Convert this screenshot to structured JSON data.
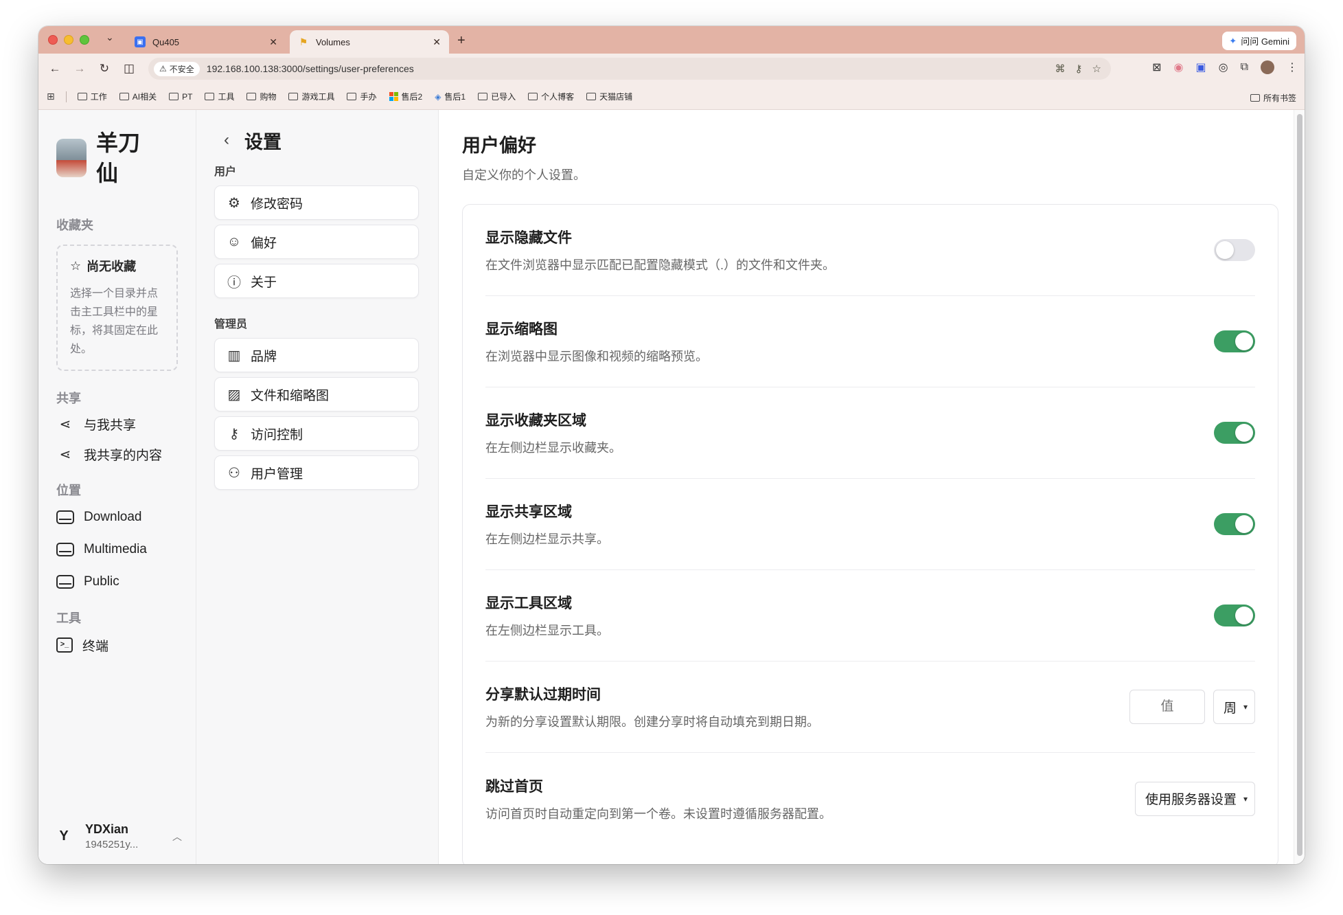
{
  "browser": {
    "tabs": [
      {
        "title": "Qu405",
        "favicon": "app-square-icon"
      },
      {
        "title": "Volumes",
        "favicon": "folder-flag-icon"
      }
    ],
    "gemini_label": "问问 Gemini",
    "security_label": "不安全",
    "url": "192.168.100.138:3000/settings/user-preferences",
    "bookmarks": [
      "工作",
      "AI相关",
      "PT",
      "工具",
      "购物",
      "游戏工具",
      "手办",
      "售后2",
      "售后1",
      "已导入",
      "个人博客",
      "天猫店铺"
    ],
    "all_bookmarks": "所有书签"
  },
  "sidebar": {
    "brand": "羊刀仙",
    "favorites_heading": "收藏夹",
    "favorites_empty_title": "尚无收藏",
    "favorites_empty_text": "选择一个目录并点击主工具栏中的星标，将其固定在此处。",
    "shared_heading": "共享",
    "shared_items": [
      "与我共享",
      "我共享的内容"
    ],
    "locations_heading": "位置",
    "locations": [
      "Download",
      "Multimedia",
      "Public"
    ],
    "tools_heading": "工具",
    "tools": [
      "终端"
    ],
    "user": {
      "initial": "Y",
      "name": "YDXian",
      "email": "1945251y..."
    }
  },
  "settings_nav": {
    "title": "设置",
    "user_group": "用户",
    "user_items": [
      "修改密码",
      "偏好",
      "关于"
    ],
    "admin_group": "管理员",
    "admin_items": [
      "品牌",
      "文件和缩略图",
      "访问控制",
      "用户管理"
    ]
  },
  "main": {
    "title": "用户偏好",
    "subtitle": "自定义你的个人设置。",
    "rows": [
      {
        "title": "显示隐藏文件",
        "desc": "在文件浏览器中显示匹配已配置隐藏模式（.）的文件和文件夹。",
        "enabled": false
      },
      {
        "title": "显示缩略图",
        "desc": "在浏览器中显示图像和视频的缩略预览。",
        "enabled": true
      },
      {
        "title": "显示收藏夹区域",
        "desc": "在左侧边栏显示收藏夹。",
        "enabled": true
      },
      {
        "title": "显示共享区域",
        "desc": "在左侧边栏显示共享。",
        "enabled": true
      },
      {
        "title": "显示工具区域",
        "desc": "在左侧边栏显示工具。",
        "enabled": true
      },
      {
        "title": "分享默认过期时间",
        "desc": "为新的分享设置默认期限。创建分享时将自动填充到期日期。",
        "value_placeholder": "值",
        "unit": "周"
      },
      {
        "title": "跳过首页",
        "desc": "访问首页时自动重定向到第一个卷。未设置时遵循服务器配置。",
        "select_value": "使用服务器设置"
      }
    ]
  },
  "colors": {
    "toggle_on": "#3c9e63",
    "toggle_off": "#e5e5ea",
    "chrome": "#e3b3a5"
  }
}
